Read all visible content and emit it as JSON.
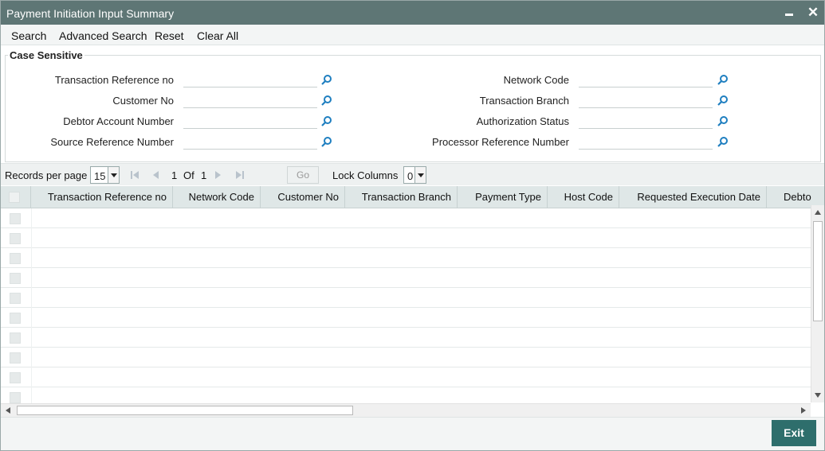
{
  "window": {
    "title": "Payment Initiation Input Summary"
  },
  "menu": [
    "Search",
    "Advanced Search",
    "Reset",
    "Clear All"
  ],
  "search": {
    "legend": "Case Sensitive",
    "left_fields": [
      {
        "label": "Transaction Reference no",
        "value": ""
      },
      {
        "label": "Customer No",
        "value": ""
      },
      {
        "label": "Debtor Account Number",
        "value": ""
      },
      {
        "label": "Source Reference Number",
        "value": ""
      }
    ],
    "right_fields": [
      {
        "label": "Network Code",
        "value": ""
      },
      {
        "label": "Transaction Branch",
        "value": ""
      },
      {
        "label": "Authorization Status",
        "value": ""
      },
      {
        "label": "Processor Reference Number",
        "value": ""
      }
    ]
  },
  "pager": {
    "records_per_page_label": "Records per page",
    "records_per_page": "15",
    "current_page": "1",
    "of_label": "Of",
    "total_pages": "1",
    "go_label": "Go",
    "lock_columns_label": "Lock Columns",
    "lock_columns": "0"
  },
  "grid": {
    "columns": [
      "Transaction Reference no",
      "Network Code",
      "Customer No",
      "Transaction Branch",
      "Payment Type",
      "Host Code",
      "Requested Execution Date",
      "Debto"
    ],
    "row_count": 10
  },
  "footer": {
    "exit_label": "Exit"
  },
  "colors": {
    "titlebar": "#5e7675",
    "accent": "#2e6e6c",
    "header": "#dfe7e7"
  }
}
